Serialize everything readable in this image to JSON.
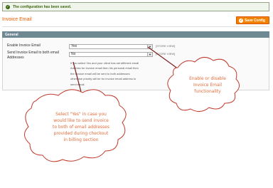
{
  "message": {
    "text": "The configuration has been saved."
  },
  "header": {
    "title": "Invoice Email",
    "save_label": "Save Config"
  },
  "section": {
    "title": "General"
  },
  "fields": [
    {
      "label": "Enable Invoice Email",
      "value": "Yes",
      "scope": "[STORE VIEW]"
    },
    {
      "label_line1": "Send Invoice Email to both email",
      "label_line2": "Addresses",
      "value": "No",
      "scope": "[STORE VIEW]"
    }
  ],
  "note_lines": [
    "If you select Yes and your client has set different email",
    "Address for invoice email then his personal email then",
    "the invoice email will be sent to both addresses",
    "otherwise priority will be for invoice email address to",
    "send email."
  ],
  "callouts": {
    "right": [
      "Enable or disable",
      "Invoice Email",
      "functionality"
    ],
    "left": [
      "Select \"Yes\" in case you",
      "would like to send invoice",
      "to both of email addresses",
      "provided during checkout",
      "in billing section"
    ]
  },
  "colors": {
    "accent": "#eb5e00",
    "callout_text": "#e26c3a",
    "callout_border": "#c0392b"
  }
}
